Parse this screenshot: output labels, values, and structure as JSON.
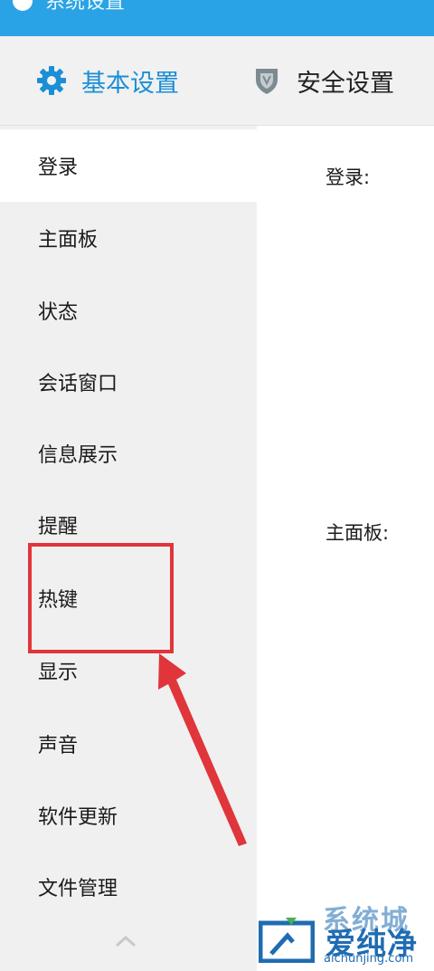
{
  "window": {
    "title": "系统设置"
  },
  "tabs": [
    {
      "label": "基本设置",
      "icon": "gear-icon",
      "active": true
    },
    {
      "label": "安全设置",
      "icon": "shield-icon",
      "active": false
    }
  ],
  "sidebar": {
    "items": [
      {
        "label": "登录"
      },
      {
        "label": "主面板"
      },
      {
        "label": "状态"
      },
      {
        "label": "会话窗口"
      },
      {
        "label": "信息展示"
      },
      {
        "label": "提醒"
      },
      {
        "label": "热键"
      },
      {
        "label": "显示"
      },
      {
        "label": "声音"
      },
      {
        "label": "软件更新"
      },
      {
        "label": "文件管理"
      }
    ],
    "scroll_icon": "chevron-up-icon"
  },
  "content": {
    "login_heading": "登录:",
    "panel_heading": "主面板:"
  },
  "annotation": {
    "color": "#e0353a"
  },
  "watermark": {
    "top": "系统城",
    "name": "爱纯净",
    "url": "aichunjing.com"
  },
  "colors": {
    "accent": "#1b8fd6",
    "titlebar": "#2aa3e6"
  }
}
